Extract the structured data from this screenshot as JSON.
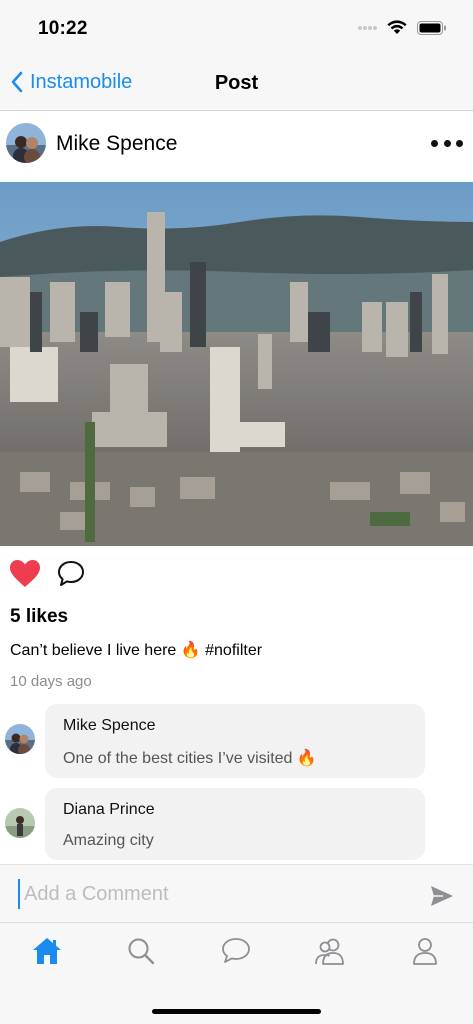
{
  "status_bar": {
    "time": "10:22"
  },
  "nav": {
    "back_label": "Instamobile",
    "title": "Post"
  },
  "post": {
    "author": "Mike Spence",
    "likes": "5 likes",
    "caption": "Can’t believe I live here 🔥 #nofilter",
    "time_ago": "10 days ago",
    "liked": true
  },
  "comments": [
    {
      "author": "Mike Spence",
      "text": "One of the best cities I’ve visited 🔥"
    },
    {
      "author": "Diana Prince",
      "text": "Amazing city"
    }
  ],
  "comment_input": {
    "placeholder": "Add a Comment",
    "value": ""
  },
  "tabs": [
    "home-icon",
    "search-icon",
    "chat-bubble-icon",
    "people-icon",
    "profile-icon"
  ],
  "active_tab": "home",
  "colors": {
    "accent": "#1a8cf0",
    "heart": "#ee3d4f",
    "bubble": "#f2f2f2",
    "muted": "#8c8c8c"
  }
}
